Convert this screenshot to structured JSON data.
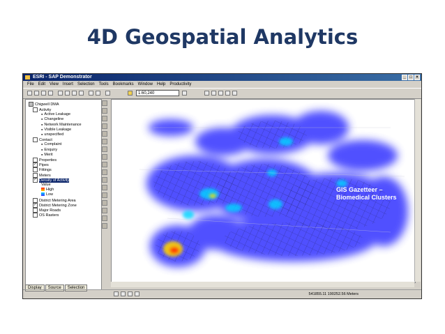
{
  "slide": {
    "title": "4D Geospatial Analytics"
  },
  "window": {
    "title": "ESRI - SAP Demonstrator",
    "menu": [
      "File",
      "Edit",
      "View",
      "Insert",
      "Selection",
      "Tools",
      "Bookmarks",
      "Window",
      "Help",
      "Productivity"
    ],
    "scale": "1:60,240"
  },
  "toc": {
    "root": "Chigwell DMA",
    "items": [
      {
        "label": "Activity",
        "indent": 1,
        "checkbox": true,
        "checked": false
      },
      {
        "label": "Active Leakage",
        "indent": 3,
        "checkbox": false
      },
      {
        "label": "Changeline",
        "indent": 3,
        "checkbox": false
      },
      {
        "label": "Network Maintenance",
        "indent": 3,
        "checkbox": false
      },
      {
        "label": "Visible Leakage",
        "indent": 3,
        "checkbox": false
      },
      {
        "label": "unspecified",
        "indent": 3,
        "checkbox": false
      },
      {
        "label": "Contact",
        "indent": 1,
        "checkbox": true,
        "checked": false
      },
      {
        "label": "Complaint",
        "indent": 3,
        "checkbox": false
      },
      {
        "label": "Enquiry",
        "indent": 3,
        "checkbox": false
      },
      {
        "label": "Merit",
        "indent": 3,
        "checkbox": false
      },
      {
        "label": "Properties",
        "indent": 1,
        "checkbox": true,
        "checked": false
      },
      {
        "label": "Pipes",
        "indent": 1,
        "checkbox": true,
        "checked": true
      },
      {
        "label": "Fittings",
        "indent": 1,
        "checkbox": true,
        "checked": false
      },
      {
        "label": "Meters",
        "indent": 1,
        "checkbox": true,
        "checked": false
      },
      {
        "label": "Density of Activity",
        "indent": 1,
        "checkbox": true,
        "checked": true,
        "selected": true
      },
      {
        "label": "Value",
        "indent": 3,
        "checkbox": false
      },
      {
        "label": "High",
        "indent": 3,
        "checkbox": false
      },
      {
        "label": "Low",
        "indent": 3,
        "checkbox": false
      },
      {
        "label": "District Metering Area",
        "indent": 1,
        "checkbox": true,
        "checked": false
      },
      {
        "label": "District Metering Zone",
        "indent": 1,
        "checkbox": true,
        "checked": true
      },
      {
        "label": "Major Roads",
        "indent": 1,
        "checkbox": true,
        "checked": false
      },
      {
        "label": "OS Rasters",
        "indent": 1,
        "checkbox": true,
        "checked": false
      }
    ],
    "tabs": [
      "Display",
      "Source",
      "Selection"
    ]
  },
  "map": {
    "caption_line1": "GIS Gazetteer –",
    "caption_line2": "Biomedical Clusters"
  },
  "status": {
    "coords": "541855.11  190252.56 Meters"
  },
  "colors": {
    "heat_low": "#3a3aff",
    "heat_mid": "#00d0ff",
    "heat_high": "#ff3000",
    "title": "#1f3864"
  }
}
